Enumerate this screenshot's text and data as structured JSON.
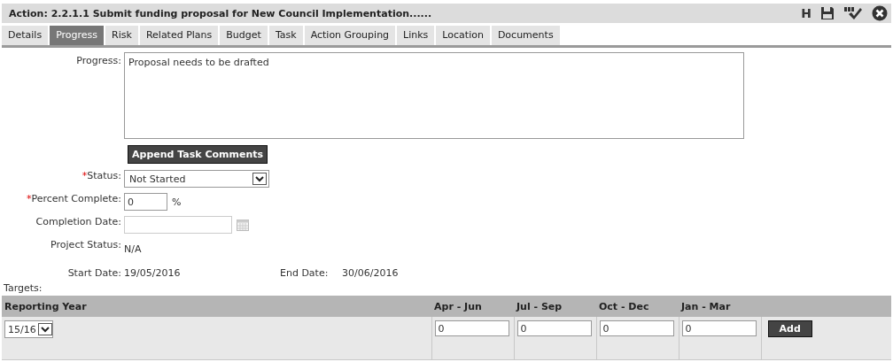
{
  "title": "Action: 2.2.1.1 Submit funding proposal for New Council Implementation......",
  "toolbar": [
    {
      "kind": "letter",
      "text": "H"
    },
    {
      "kind": "save"
    },
    {
      "kind": "spellcheck"
    },
    {
      "kind": "close"
    }
  ],
  "tabs": [
    {
      "label": "Details",
      "selected": false
    },
    {
      "label": "Progress",
      "selected": true
    },
    {
      "label": "Risk",
      "selected": false
    },
    {
      "label": "Related Plans",
      "selected": false
    },
    {
      "label": "Budget",
      "selected": false
    },
    {
      "label": "Task",
      "selected": false
    },
    {
      "label": "Action Grouping",
      "selected": false
    },
    {
      "label": "Links",
      "selected": false
    },
    {
      "label": "Location",
      "selected": false
    },
    {
      "label": "Documents",
      "selected": false
    }
  ],
  "progress": {
    "label": "Progress:",
    "value": "Proposal needs to be drafted"
  },
  "append_button": "Append Task Comments",
  "status": {
    "required_mark": "*",
    "label": "Status:",
    "value": "Not Started"
  },
  "percent": {
    "required_mark": "*",
    "label": "Percent Complete:",
    "value": "0",
    "unit": "%"
  },
  "completion_date": {
    "label": "Completion Date:",
    "disabled": true
  },
  "project_status": {
    "label": "Project Status:",
    "value": "N/A"
  },
  "start_date": {
    "label": "Start Date:",
    "value": "19/05/2016"
  },
  "end_date": {
    "label": "End Date:",
    "value": "30/06/2016"
  },
  "targets": {
    "label": "Targets:",
    "columns": [
      "Reporting Year",
      "Apr - Jun",
      "Jul - Sep",
      "Oct - Dec",
      "Jan - Mar"
    ],
    "year": "15/16",
    "values": [
      "0",
      "0",
      "0",
      "0"
    ],
    "add_button": "Add"
  }
}
